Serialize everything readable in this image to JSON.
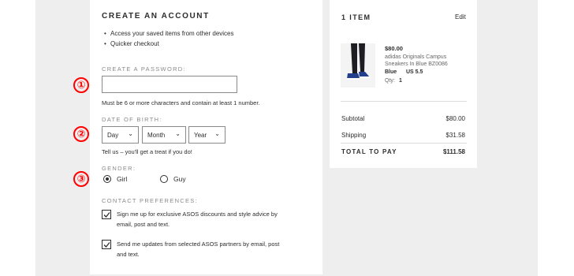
{
  "account": {
    "title": "CREATE AN ACCOUNT",
    "bullets": [
      "Access your saved items from other devices",
      "Quicker checkout"
    ],
    "password": {
      "label": "CREATE A PASSWORD:",
      "value": "",
      "hint": "Must be 6 or more characters and contain at least 1 number."
    },
    "dob": {
      "label": "DATE OF BIRTH:",
      "day": "Day",
      "month": "Month",
      "year": "Year",
      "hint": "Tell us – you'll get a treat if you do!"
    },
    "gender": {
      "label": "GENDER:",
      "options": [
        {
          "label": "Girl",
          "selected": true
        },
        {
          "label": "Guy",
          "selected": false
        }
      ]
    },
    "contact": {
      "label": "CONTACT PREFERENCES:",
      "options": [
        {
          "text": "Sign me up for exclusive ASOS discounts and style advice by email, post and text.",
          "checked": true
        },
        {
          "text": "Send me updates from selected ASOS partners by email, post and text.",
          "checked": true
        }
      ]
    }
  },
  "annotations": [
    "①",
    "②",
    "③"
  ],
  "bag": {
    "title": "1 ITEM",
    "edit_label": "Edit",
    "item": {
      "price": "$80.00",
      "name": "adidas Originals Campus Sneakers In Blue BZ0086",
      "color": "Blue",
      "size": "US 5.5",
      "qty_label": "Qty:",
      "qty": "1"
    },
    "subtotal_label": "Subtotal",
    "subtotal": "$80.00",
    "shipping_label": "Shipping",
    "shipping": "$31.58",
    "total_label": "TOTAL TO PAY",
    "total": "$111.58"
  },
  "colors": {
    "accent": "#ff0000",
    "text": "#2d2d2d",
    "label": "#8a8a8a",
    "background": "#eeeeee"
  }
}
